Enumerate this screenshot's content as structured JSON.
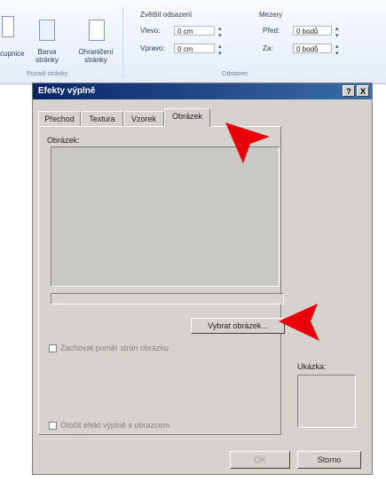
{
  "ribbon": {
    "left_partial_label": "cupnice",
    "button_barva_label": "Barva stránky",
    "button_ohraniceni_label": "Ohraničení stránky",
    "group_odsazeni_title": "Zvětšit odsazení",
    "group_mezery_title": "Mezery",
    "vlevo_label": "Vlevo:",
    "vlevo_value": "0 cm",
    "vpravo_label": "Vpravo:",
    "vpravo_value": "0 cm",
    "pred_label": "Před:",
    "pred_value": "0 bodů",
    "za_label": "Za:",
    "za_value": "0 bodů",
    "group_footer_left": "Pozadí stránky",
    "group_footer_right": "Odstavec"
  },
  "dialog": {
    "title": "Efekty výplně",
    "help_label": "?",
    "close_label": "X",
    "tabs": [
      {
        "label": "Přechod"
      },
      {
        "label": "Textura"
      },
      {
        "label": "Vzorek"
      },
      {
        "label": "Obrázek"
      }
    ],
    "active_tab": "Obrázek",
    "picture_label": "Obrázek:",
    "select_picture_button": "Vybrat obrázek...",
    "lock_aspect_label": "Zachovat poměr stran obrázku",
    "rotate_with_shape_label": "Otočit efekt výplně s obrazcem",
    "sample_label": "Ukázka:",
    "ok_button": "OK",
    "cancel_button": "Storno"
  },
  "colors": {
    "dialog_face": "#d6d3ce",
    "title_bar": "#0a246a",
    "arrow": "#e8000b"
  }
}
